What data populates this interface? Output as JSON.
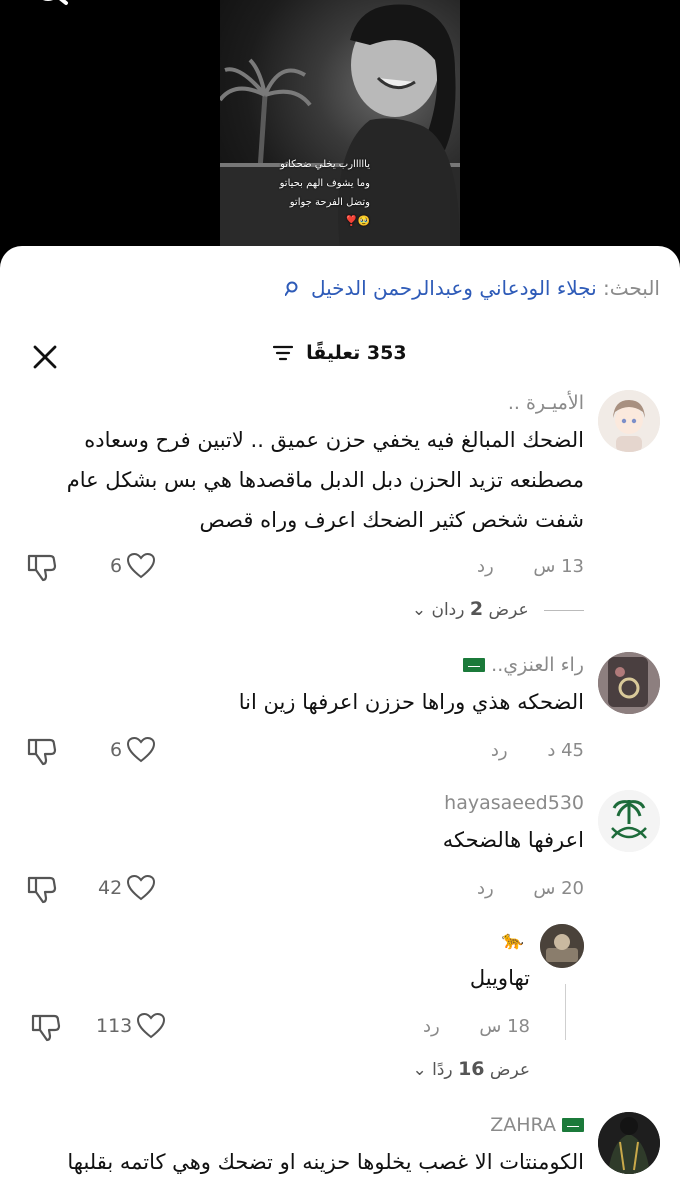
{
  "video": {
    "caption_lines": [
      "يااااارب يخلي ضحكاتو",
      "وما يشوف الهم بحياتو",
      "وتضل الفرحة جواتو",
      "🥹❣️"
    ]
  },
  "search": {
    "prefix": "البحث:",
    "query": "نجلاء الودعاني وعبدالرحمن الدخيل"
  },
  "header": {
    "comment_count": "353 تعليقًا"
  },
  "comments": [
    {
      "username": "الأميـرة ..",
      "text": "الضحك المبالغ فيه يخفي حزن عميق .. لاتبين فرح وسعاده مصطنعه تزيد الحزن دبل الدبل ماقصدها هي بس بشكل عام شفت شخص كثير الضحك اعرف وراه قصص",
      "time": "13 س",
      "reply_label": "رد",
      "likes": "6",
      "replies_prefix": "عرض",
      "replies_count": "2",
      "replies_suffix": "ردان"
    },
    {
      "username": "راء العنزي..",
      "text": "الضحكه هذي وراها حززن اعرفها زين انا",
      "time": "45 د",
      "reply_label": "رد",
      "likes": "6"
    },
    {
      "username": "hayasaeed530",
      "text": "اعرفها هالضحكه",
      "time": "20 س",
      "reply_label": "رد",
      "likes": "42"
    },
    {
      "username": "🐆",
      "text": "تهاوييل",
      "time": "18 س",
      "reply_label": "رد",
      "likes": "113",
      "replies_prefix": "عرض",
      "replies_count": "16",
      "replies_suffix": "ردًا"
    },
    {
      "username": "ZAHRA",
      "text": "الكومنتات الا غصب يخلوها حزينه او تضحك وهي كاتمه بقلبها"
    }
  ],
  "colors": {
    "link_blue": "#2e5bb8",
    "muted_gray": "#8a8a8a",
    "sheet_bg": "#ffffff"
  }
}
